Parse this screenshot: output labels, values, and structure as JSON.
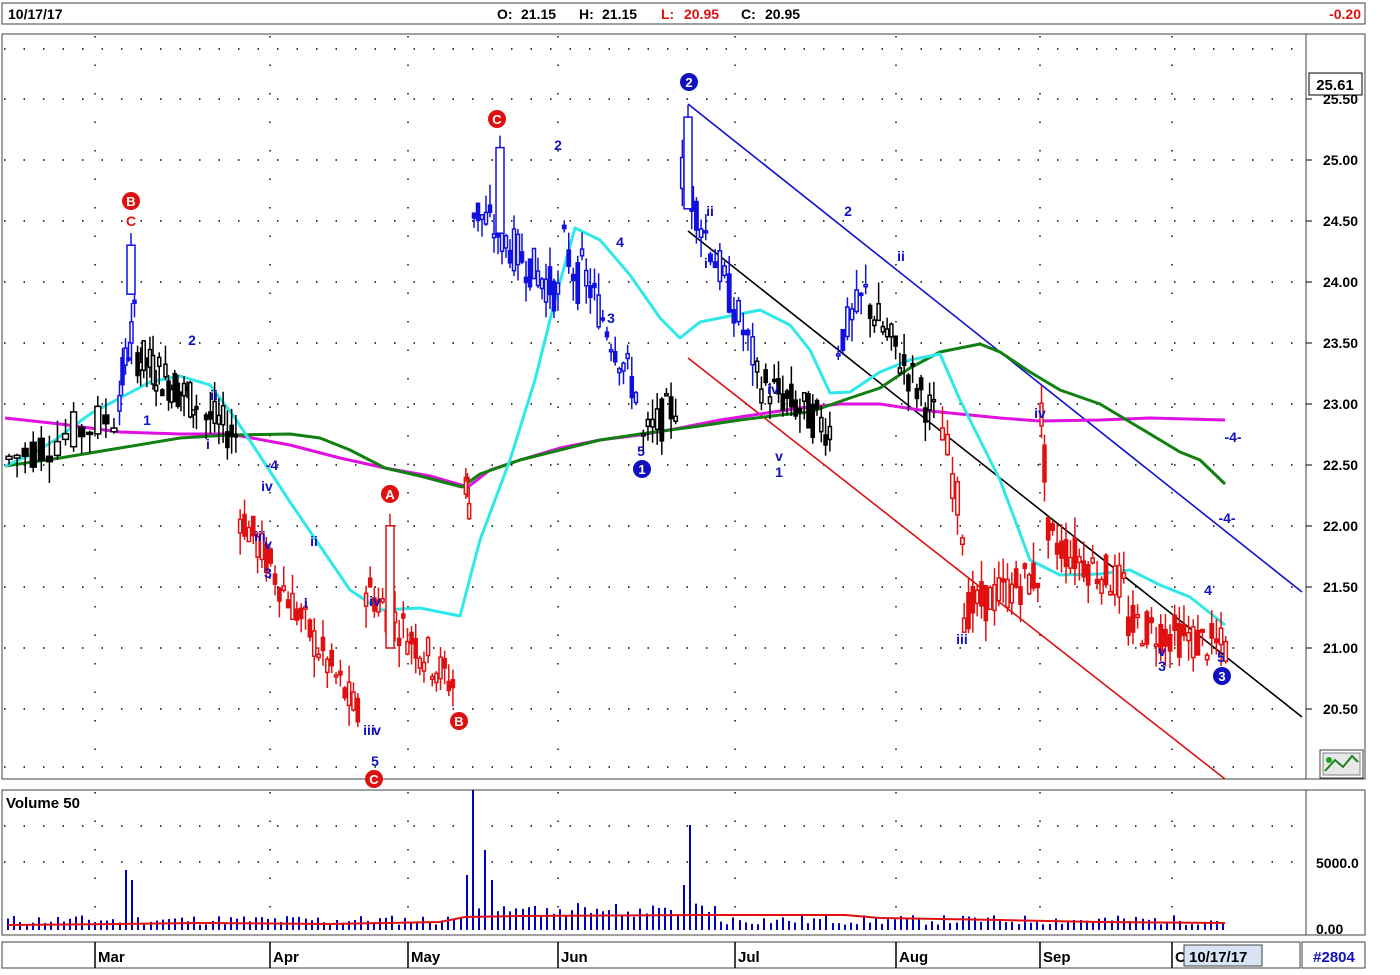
{
  "header": {
    "date": "10/17/17",
    "open_label": "O:",
    "open": "21.15",
    "high_label": "H:",
    "high": "21.15",
    "low_label": "L:",
    "low": "20.95",
    "close_label": "C:",
    "close": "20.95",
    "change": "-0.20"
  },
  "colors": {
    "up_trend": "#1010e0",
    "down_trend": "#e01010",
    "neutral": "#000000",
    "ma_fast": "#30e8e8",
    "ma_mid": "#108010",
    "ma_slow": "#e010e0",
    "volume": "#0000c0",
    "volume_avg": "#e01010",
    "wave_blue": "#1010c0",
    "wave_red": "#e01010"
  },
  "price_pane": {
    "last_price_tag": "25.61",
    "price_ticks": [
      "25.50",
      "25.00",
      "24.50",
      "24.00",
      "23.50",
      "23.00",
      "22.50",
      "22.00",
      "21.50",
      "21.00",
      "20.50"
    ]
  },
  "volume_pane": {
    "title": "Volume 50",
    "ticks": [
      "5000.0",
      "0.00"
    ]
  },
  "time_axis": {
    "months": [
      "Mar",
      "Apr",
      "May",
      "Jun",
      "Jul",
      "Aug",
      "Sep",
      "O"
    ],
    "current_date": "10/17/17",
    "symbol_box": "#2804"
  },
  "wave_labels": {
    "circled": [
      "B",
      "C",
      "A",
      "B",
      "C",
      "2",
      "1",
      "3"
    ],
    "text": [
      "C",
      "1",
      "2",
      "ii",
      "i",
      "-4",
      "iv",
      "iii",
      "v",
      "3",
      "ii",
      "i",
      "iv",
      "iii",
      "v",
      "5",
      "2",
      "4",
      "3",
      "5",
      "ii",
      "i",
      "iv",
      "v",
      "1",
      "2",
      "ii",
      "iv",
      "iii",
      "v",
      "3",
      "4",
      "5",
      "-4-",
      "-4-"
    ]
  },
  "chart_data": {
    "type": "candlestick",
    "title": "",
    "x_axis": {
      "type": "date",
      "range": [
        "2017-02-20",
        "2017-10-17"
      ],
      "tick_labels": [
        "Mar",
        "Apr",
        "May",
        "Jun",
        "Jul",
        "Aug",
        "Sep",
        "O"
      ]
    },
    "y_axis": {
      "range": [
        20.05,
        26.05
      ],
      "tick_labels": [
        "25.50",
        "25.00",
        "24.50",
        "24.00",
        "23.50",
        "23.00",
        "22.50",
        "22.00",
        "21.50",
        "21.00",
        "20.50"
      ]
    },
    "last_bar": {
      "date": "10/17/17",
      "open": 21.15,
      "high": 21.15,
      "low": 20.95,
      "close": 20.95,
      "change": -0.2
    },
    "key_points": [
      {
        "label": "B",
        "date": "2017-03-06",
        "price": 24.4
      },
      {
        "label": "C",
        "date": "2017-05-15",
        "price": 25.2
      },
      {
        "label": "2",
        "date": "2017-06-28",
        "price": 25.45
      },
      {
        "label": "1",
        "date": "2017-06-09",
        "price": 22.65
      },
      {
        "label": "3",
        "date": "2017-10-17",
        "price": 20.95
      }
    ],
    "moving_averages": [
      "cyan",
      "green",
      "magenta"
    ],
    "volume": {
      "title": "Volume 50",
      "ylim": [
        0,
        9000
      ]
    }
  }
}
